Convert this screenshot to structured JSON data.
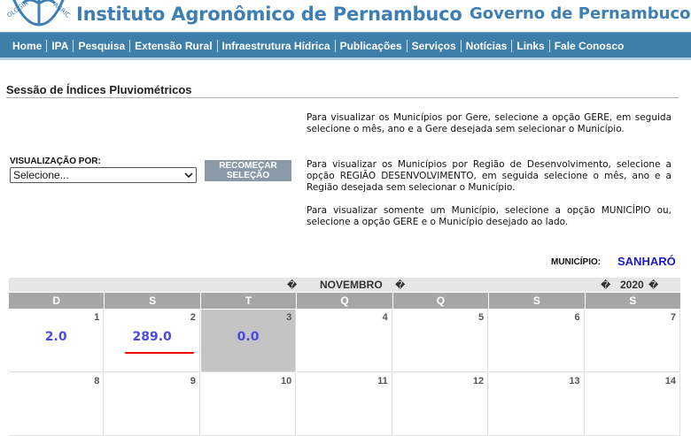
{
  "header": {
    "org_title": "Instituto Agronômico de Pernambuco",
    "gov_title": "Governo de Pernambuco",
    "logo_text": "OLOGIA AGRIC"
  },
  "nav": {
    "items": [
      "Home",
      "IPA",
      "Pesquisa",
      "Extensão Rural",
      "Infraestrutura Hídrica",
      "Publicações",
      "Serviços",
      "Notícias",
      "Links",
      "Fale Conosco"
    ]
  },
  "section_title": "Sessão de Índices Pluviométricos",
  "form": {
    "label": "VISUALIZAÇÃO POR:",
    "select_value": "Selecione...",
    "reset_line1": "RECOMEÇAR",
    "reset_line2": "SELEÇÃO"
  },
  "instructions": [
    "Para visualizar os Municípios por Gere, selecione a opção GERE, em seguida selecione o mês, ano e a Gere desejada sem selecionar o Município.",
    "Para visualizar os Municípios por Região de Desenvolvimento, selecione a opção REGIÃO DESENVOLVIMENTO, em seguida selecione o mês, ano e a Região desejada sem selecionar o Município.",
    "Para visualizar somente um Município, selecione a opção MUNICÍPIO ou, selecione a opção GERE e o Município desejado ao lado."
  ],
  "municipio": {
    "label": "MUNICÍPIO:",
    "value": "SANHARÓ"
  },
  "calendar": {
    "month": "NOVEMBRO",
    "year": "2020",
    "arrow_glyph": "�",
    "weekdays": [
      "D",
      "S",
      "T",
      "Q",
      "Q",
      "S",
      "S"
    ],
    "week1": [
      {
        "day": "1",
        "value": "2.0"
      },
      {
        "day": "2",
        "value": "289.0"
      },
      {
        "day": "3",
        "value": "0.0"
      },
      {
        "day": "4",
        "value": ""
      },
      {
        "day": "5",
        "value": ""
      },
      {
        "day": "6",
        "value": ""
      },
      {
        "day": "7",
        "value": ""
      }
    ],
    "week2": [
      {
        "day": "8"
      },
      {
        "day": "9"
      },
      {
        "day": "10"
      },
      {
        "day": "11"
      },
      {
        "day": "12"
      },
      {
        "day": "13"
      },
      {
        "day": "14"
      }
    ]
  },
  "colors": {
    "brand_blue": "#3d7eb5",
    "nav_bg": "#3d7fa8",
    "value_blue": "#4a4ae0",
    "highlight_red": "#ee0000"
  }
}
